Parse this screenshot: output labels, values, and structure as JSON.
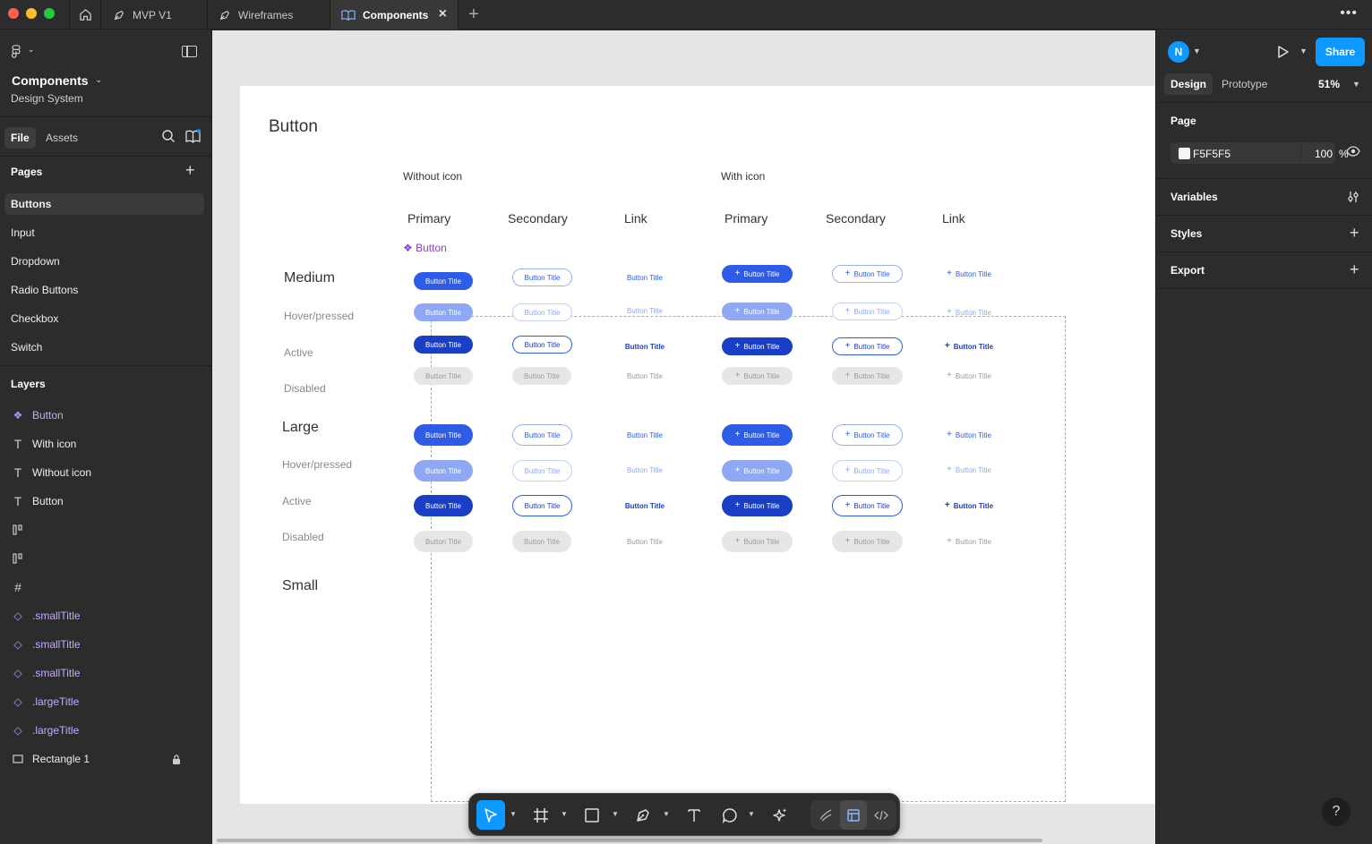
{
  "tabs": [
    {
      "label": "MVP V1",
      "icon": "pen-nib-icon"
    },
    {
      "label": "Wireframes",
      "icon": "pen-nib-icon"
    },
    {
      "label": "Components",
      "icon": "book-icon"
    }
  ],
  "left_panel": {
    "file_name": "Components",
    "project": "Design System",
    "tabs": [
      "File",
      "Assets"
    ],
    "pages_heading": "Pages",
    "pages": [
      "Buttons",
      "Input",
      "Dropdown",
      "Radio Buttons",
      "Checkbox",
      "Switch"
    ],
    "layers_heading": "Layers",
    "layers": [
      {
        "name": "Button",
        "icon": "component-icon"
      },
      {
        "name": "With icon",
        "icon": "text-icon"
      },
      {
        "name": "Without icon",
        "icon": "text-icon"
      },
      {
        "name": "Button",
        "icon": "text-icon"
      },
      {
        "name": "",
        "icon": "autolayout-icon"
      },
      {
        "name": "",
        "icon": "autolayout-icon"
      },
      {
        "name": "",
        "icon": "frame-icon"
      },
      {
        "name": ".smallTitle",
        "icon": "instance-icon"
      },
      {
        "name": ".smallTitle",
        "icon": "instance-icon"
      },
      {
        "name": ".smallTitle",
        "icon": "instance-icon"
      },
      {
        "name": ".largeTitle",
        "icon": "instance-icon"
      },
      {
        "name": ".largeTitle",
        "icon": "instance-icon"
      },
      {
        "name": "Rectangle 1",
        "icon": "rectangle-icon"
      }
    ]
  },
  "canvas": {
    "title": "Button",
    "group_without_icon": "Without icon",
    "group_with_icon": "With icon",
    "columns": [
      "Primary",
      "Secondary",
      "Link",
      "Primary",
      "Secondary",
      "Link"
    ],
    "component_label": "Button",
    "sizes": [
      "Medium",
      "Large",
      "Small"
    ],
    "states": [
      "Hover/pressed",
      "Active",
      "Disabled"
    ],
    "button_text": "Button Title"
  },
  "right_panel": {
    "avatar_initial": "N",
    "share_label": "Share",
    "tabs": [
      "Design",
      "Prototype"
    ],
    "zoom": "51%",
    "page_heading": "Page",
    "page_color": "F5F5F5",
    "page_opacity": "100",
    "opacity_unit": "%",
    "variables_heading": "Variables",
    "styles_heading": "Styles",
    "export_heading": "Export"
  },
  "colors": {
    "accent": "#0d99ff",
    "button_primary": "#2e5ce6",
    "component_purple": "#8a3cdb"
  }
}
